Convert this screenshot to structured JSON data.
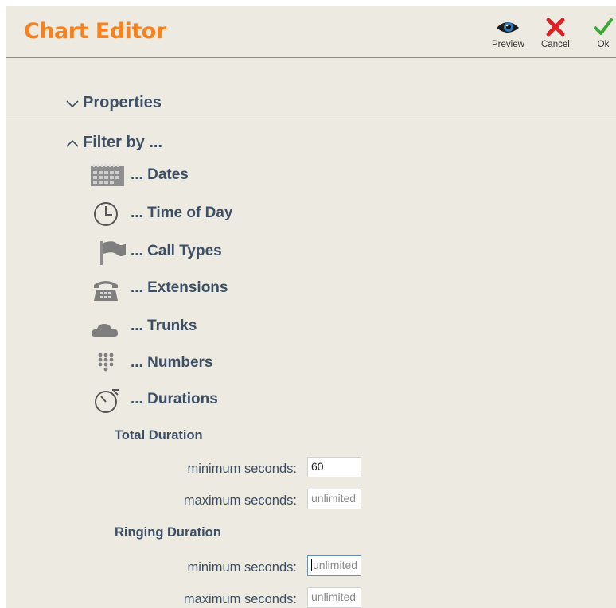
{
  "header": {
    "title": "Chart Editor",
    "preview_label": "Preview",
    "cancel_label": "Cancel",
    "ok_label": "Ok",
    "colors": {
      "title": "#f5821f",
      "cancel": "#e31e25",
      "ok": "#3aaa35"
    }
  },
  "sections": {
    "properties_label": "Properties",
    "filter_label": "Filter by ..."
  },
  "filters": {
    "dates": "... Dates",
    "time_of_day": "... Time of Day",
    "call_types": "... Call Types",
    "extensions": "... Extensions",
    "trunks": "... Trunks",
    "numbers": "... Numbers",
    "durations": "... Durations"
  },
  "durations": {
    "total": {
      "label": "Total Duration",
      "min_label": "minimum seconds:",
      "min_value": "60",
      "max_label": "maximum seconds:",
      "max_placeholder": "unlimited"
    },
    "ringing": {
      "label": "Ringing Duration",
      "min_label": "minimum seconds:",
      "min_placeholder": "unlimited",
      "max_label": "maximum seconds:",
      "max_placeholder": "unlimited"
    }
  }
}
